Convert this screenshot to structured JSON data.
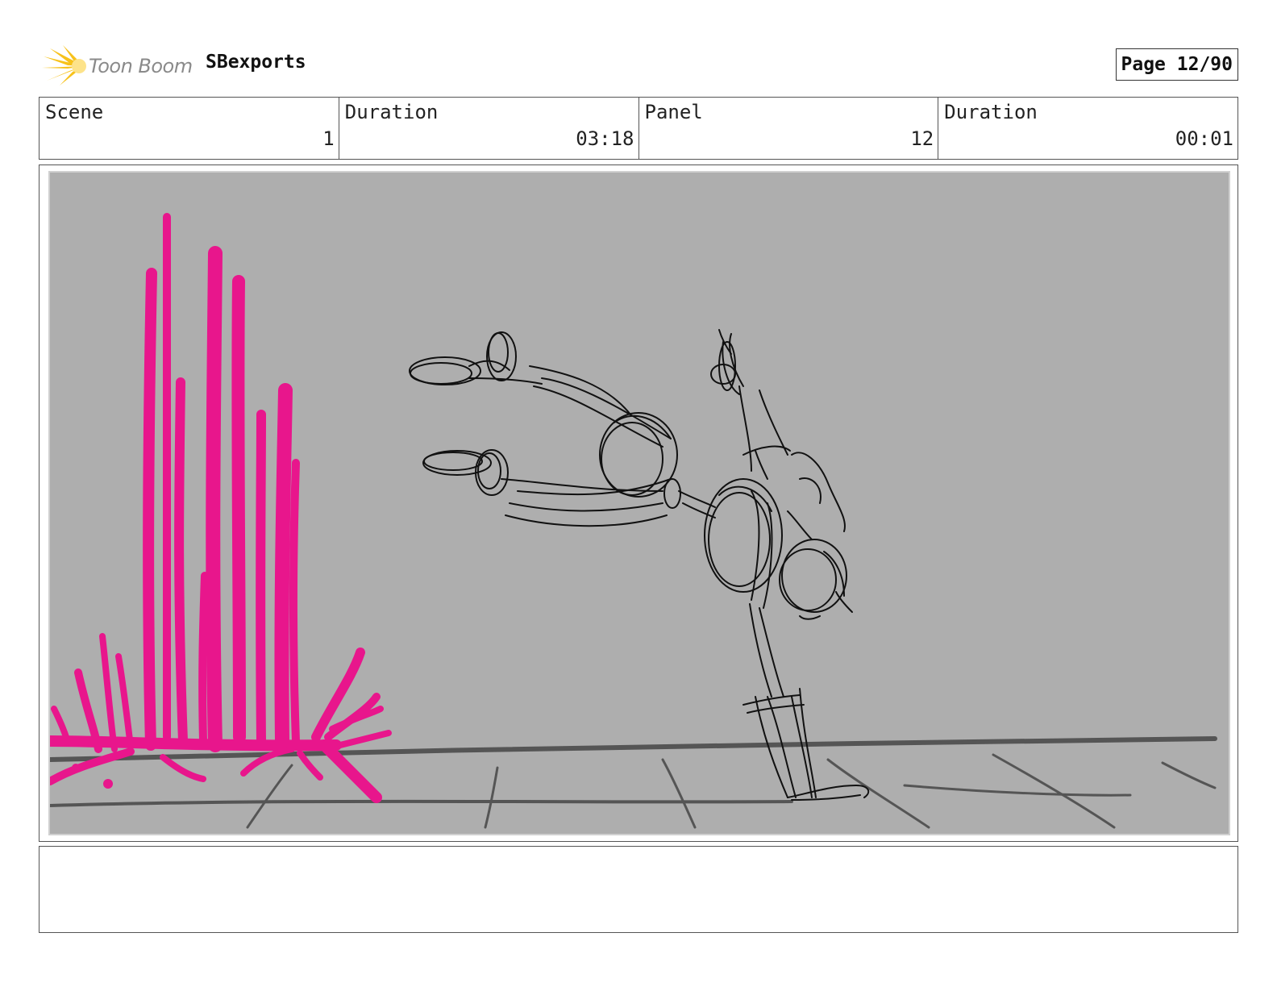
{
  "header": {
    "logo_text": "Toon Boom",
    "project_name": "SBexports",
    "page_label": "Page 12/90"
  },
  "info": {
    "scene_label": "Scene",
    "scene_value": "1",
    "scene_duration_label": "Duration",
    "scene_duration_value": "03:18",
    "panel_label": "Panel",
    "panel_value": "12",
    "panel_duration_label": "Duration",
    "panel_duration_value": "00:01"
  },
  "panel": {
    "background_color": "#aeaeae",
    "sketch_color": "#111111",
    "effect_color": "#e8168c",
    "floor_color": "#555555",
    "logo_color": "#f7c21b"
  },
  "notes": {
    "text": ""
  }
}
